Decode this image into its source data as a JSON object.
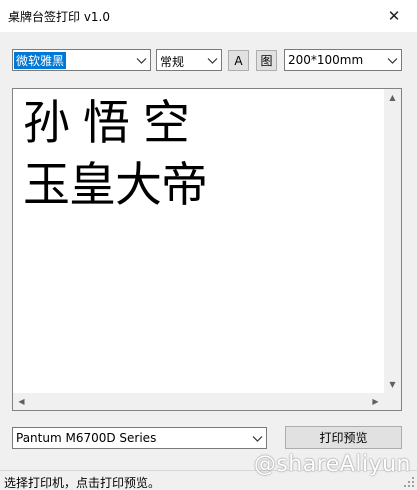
{
  "window": {
    "title": "桌牌台签打印 v1.0",
    "close_glyph": "✕"
  },
  "toolbar": {
    "font_family": "微软雅黑",
    "font_style": "常规",
    "font_button_label": "A",
    "picture_button_label": "图",
    "paper_size": "200*100mm"
  },
  "editor": {
    "content": "孙 悟 空\n玉皇大帝"
  },
  "printer": {
    "selected": "Pantum M6700D Series",
    "preview_button_label": "打印预览"
  },
  "status": {
    "message": "选择打印机，点击打印预览。"
  },
  "watermark": {
    "text": "@shareAliyun"
  },
  "icons": {
    "dropdown": "chevron-down-icon",
    "close": "close-icon"
  }
}
